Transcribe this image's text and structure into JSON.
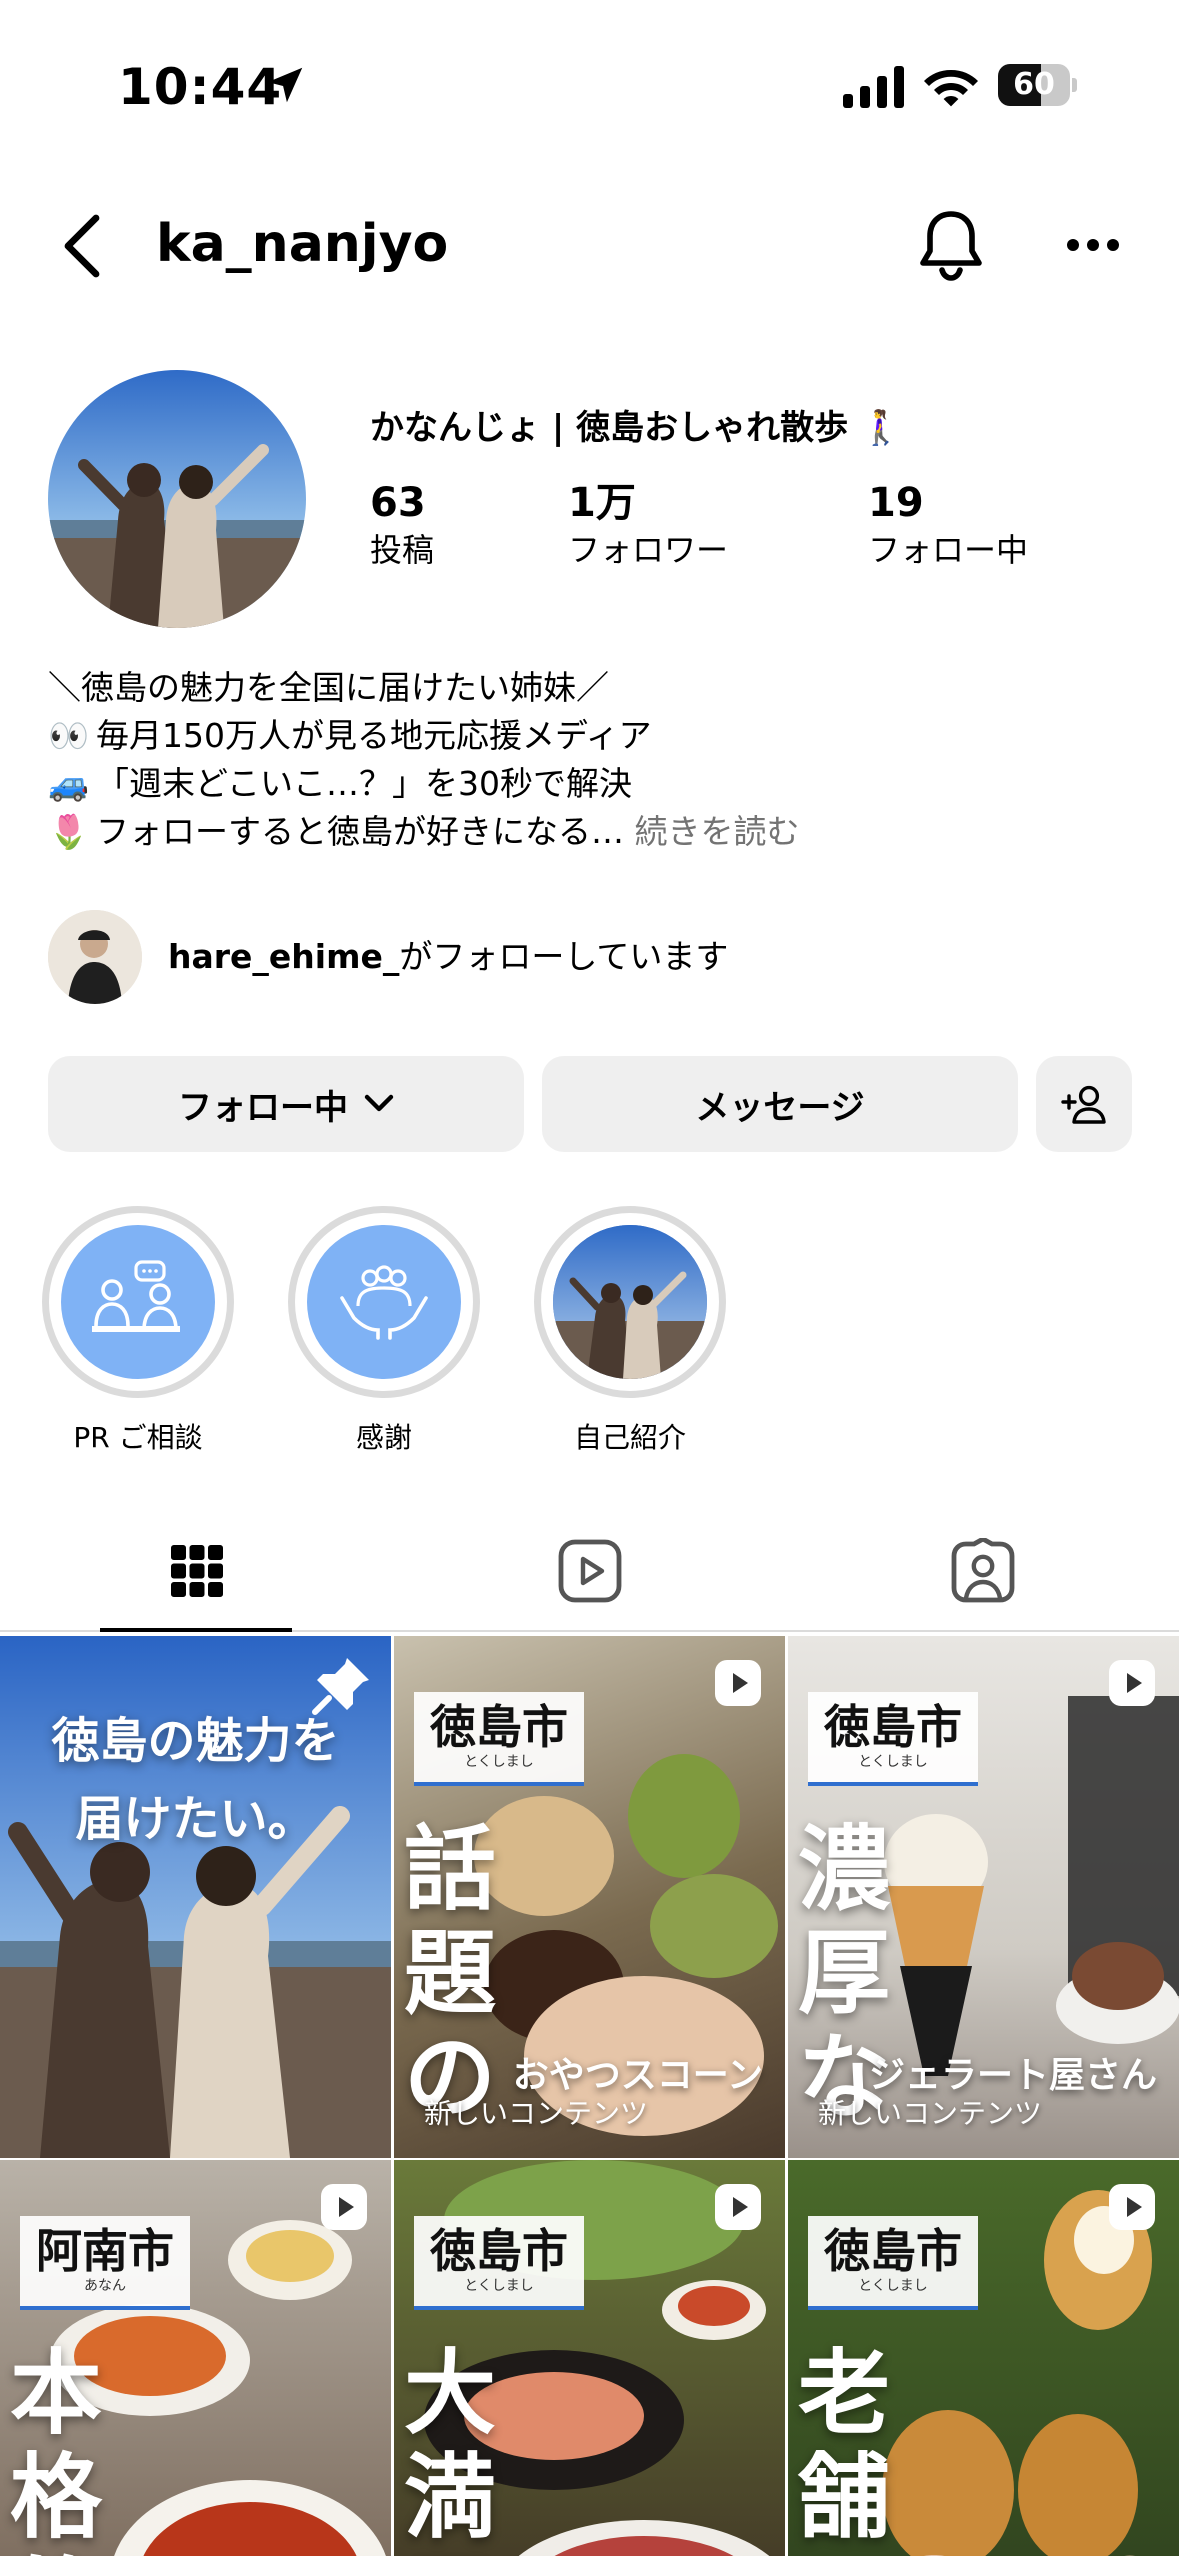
{
  "status_bar": {
    "time": "10:44",
    "battery": "60",
    "battery_level": 0.6
  },
  "header": {
    "username": "ka_nanjyo"
  },
  "profile": {
    "display_name": "かなんじょ | 徳島おしゃれ散歩 🚶‍♀️",
    "stats": [
      {
        "value": "63",
        "label": "投稿"
      },
      {
        "value": "1万",
        "label": "フォロワー"
      },
      {
        "value": "19",
        "label": "フォロー中"
      }
    ],
    "bio": [
      {
        "emoji": "",
        "text": "＼徳島の魅力を全国に届けたい姉妹／"
      },
      {
        "emoji": "👀",
        "text": "毎月150万人が見る地元応援メディア"
      },
      {
        "emoji": "🚙",
        "text": "「週末どこいこ…？」を30秒で解決"
      },
      {
        "emoji": "🌷",
        "text": "フォローすると徳島が好きになる…"
      }
    ],
    "more_link": "続きを読む",
    "followed_by_user": "hare_ehime_",
    "followed_by_suffix": "がフォローしています"
  },
  "buttons": {
    "following": "フォロー中",
    "message": "メッセージ"
  },
  "highlights": [
    {
      "label": "PR ご相談",
      "icon": "consultation-icon"
    },
    {
      "label": "感謝",
      "icon": "hands-people-icon"
    },
    {
      "label": "自己紹介",
      "icon": "photo"
    }
  ],
  "tabs": [
    {
      "name": "grid-icon"
    },
    {
      "name": "reels-icon"
    },
    {
      "name": "tagged-icon"
    }
  ],
  "posts": [
    {
      "type": "pinned",
      "title_lines": [
        "徳島の魅力を",
        "届けたい。"
      ]
    },
    {
      "type": "reel",
      "city": "徳島市",
      "kana": "とくしまし",
      "big": "話題の",
      "sub": "おやつスコーン",
      "tag": "新しいコンテンツ"
    },
    {
      "type": "reel",
      "city": "徳島市",
      "kana": "とくしまし",
      "big": "濃厚な",
      "sub": "ジェラート屋さん",
      "tag": "新しいコンテンツ"
    },
    {
      "type": "reel",
      "city": "阿南市",
      "kana": "あなん",
      "big": "本格的",
      "sub": "",
      "tag": ""
    },
    {
      "type": "reel",
      "city": "徳島市",
      "kana": "とくしまし",
      "big": "大満足",
      "sub": "",
      "tag": ""
    },
    {
      "type": "reel",
      "city": "徳島市",
      "kana": "とくしまし",
      "big": "老舗の",
      "sub": "",
      "tag": ""
    }
  ],
  "colors": {
    "accent_blue": "#2f6fcf",
    "button_bg": "#efefef",
    "highlight_bg": "#7fb2f5",
    "muted": "#737373"
  }
}
